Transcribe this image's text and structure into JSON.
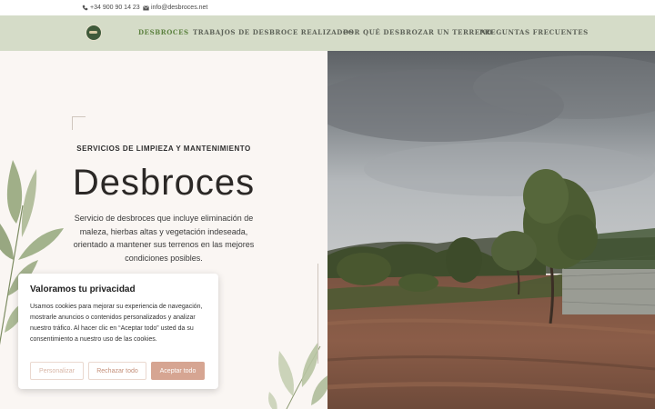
{
  "topbar": {
    "phone": "+34 900 90 14 23",
    "email": "info@desbroces.net",
    "phone_icon": "phone-icon",
    "email_icon": "envelope-icon"
  },
  "nav": {
    "logo_icon": "logo-icon",
    "links": [
      {
        "label": "Desbroces",
        "active": true
      },
      {
        "label": "Trabajos de desbroce realizados",
        "active": false
      },
      {
        "label": "Por qué desbrozar un terreno",
        "active": false
      },
      {
        "label": "Preguntas frecuentes",
        "active": false
      }
    ]
  },
  "hero": {
    "subtitle": "SERVICIOS DE LIMPIEZA Y MANTENIMIENTO",
    "title": "Desbroces",
    "description": "Servicio de desbroces que incluye eliminación de maleza, hierbas altas y vegetación indeseada, orientado a mantener sus terrenos en las mejores condiciones posibles."
  },
  "cookie_banner": {
    "title": "Valoramos tu privacidad",
    "text": "Usamos cookies para mejorar su experiencia de navegación, mostrarle anuncios o contenidos personalizados y analizar nuestro tráfico. Al hacer clic en “Aceptar todo” usted da su consentimiento a nuestro uso de las cookies.",
    "buttons": {
      "personalize": "Personalizar",
      "reject": "Rechazar todo",
      "accept": "Aceptar todo"
    }
  },
  "colors": {
    "nav_bg": "#d5dcc8",
    "nav_active": "#5d8240",
    "accept_button": "#d6a592",
    "page_bg": "#faf6f3"
  }
}
